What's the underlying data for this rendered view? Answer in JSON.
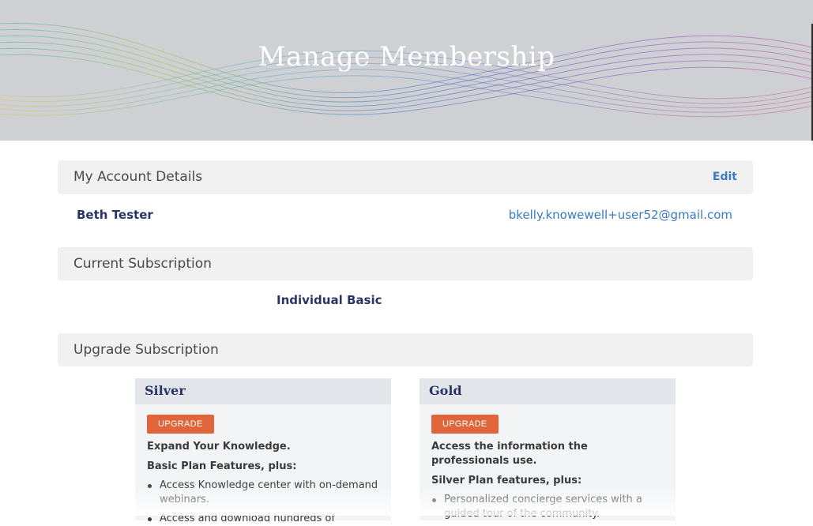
{
  "hero": {
    "title": "Manage Membership"
  },
  "account": {
    "section_title": "My Account Details",
    "edit_label": "Edit",
    "name": "Beth Tester",
    "email": "bkelly.knowewell+user52@gmail.com"
  },
  "subscription": {
    "section_title": "Current Subscription",
    "plan": "Individual Basic"
  },
  "upgrade": {
    "section_title": "Upgrade Subscription",
    "cards": [
      {
        "name": "Silver",
        "button": "UPGRADE",
        "tagline": "Expand Your Knowledge.",
        "features_title": "Basic Plan Features, plus:",
        "features": [
          "Access Knowledge center with on-demand webinars.",
          "Access and download hundreds of"
        ]
      },
      {
        "name": "Gold",
        "button": "UPGRADE",
        "tagline": "Access the information the professionals use.",
        "features_title": "Silver Plan features, plus:",
        "features": [
          "Personalized concierge services with a guided tour of the community."
        ]
      }
    ]
  },
  "colors": {
    "accent": "#e0653a",
    "link": "#3a7bc4",
    "heading": "#2a3566"
  }
}
